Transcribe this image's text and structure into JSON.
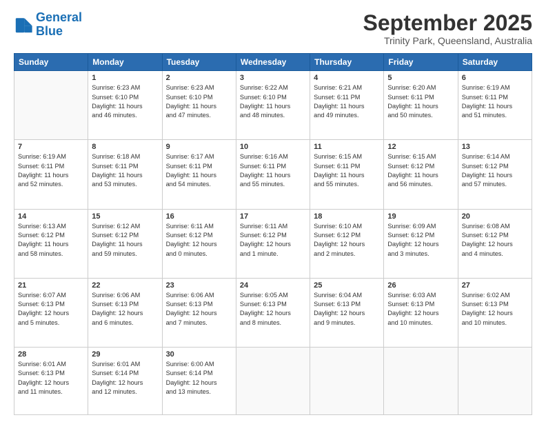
{
  "header": {
    "logo_line1": "General",
    "logo_line2": "Blue",
    "title": "September 2025",
    "subtitle": "Trinity Park, Queensland, Australia"
  },
  "days_of_week": [
    "Sunday",
    "Monday",
    "Tuesday",
    "Wednesday",
    "Thursday",
    "Friday",
    "Saturday"
  ],
  "weeks": [
    [
      {
        "day": "",
        "info": ""
      },
      {
        "day": "1",
        "info": "Sunrise: 6:23 AM\nSunset: 6:10 PM\nDaylight: 11 hours\nand 46 minutes."
      },
      {
        "day": "2",
        "info": "Sunrise: 6:23 AM\nSunset: 6:10 PM\nDaylight: 11 hours\nand 47 minutes."
      },
      {
        "day": "3",
        "info": "Sunrise: 6:22 AM\nSunset: 6:10 PM\nDaylight: 11 hours\nand 48 minutes."
      },
      {
        "day": "4",
        "info": "Sunrise: 6:21 AM\nSunset: 6:11 PM\nDaylight: 11 hours\nand 49 minutes."
      },
      {
        "day": "5",
        "info": "Sunrise: 6:20 AM\nSunset: 6:11 PM\nDaylight: 11 hours\nand 50 minutes."
      },
      {
        "day": "6",
        "info": "Sunrise: 6:19 AM\nSunset: 6:11 PM\nDaylight: 11 hours\nand 51 minutes."
      }
    ],
    [
      {
        "day": "7",
        "info": "Sunrise: 6:19 AM\nSunset: 6:11 PM\nDaylight: 11 hours\nand 52 minutes."
      },
      {
        "day": "8",
        "info": "Sunrise: 6:18 AM\nSunset: 6:11 PM\nDaylight: 11 hours\nand 53 minutes."
      },
      {
        "day": "9",
        "info": "Sunrise: 6:17 AM\nSunset: 6:11 PM\nDaylight: 11 hours\nand 54 minutes."
      },
      {
        "day": "10",
        "info": "Sunrise: 6:16 AM\nSunset: 6:11 PM\nDaylight: 11 hours\nand 55 minutes."
      },
      {
        "day": "11",
        "info": "Sunrise: 6:15 AM\nSunset: 6:11 PM\nDaylight: 11 hours\nand 55 minutes."
      },
      {
        "day": "12",
        "info": "Sunrise: 6:15 AM\nSunset: 6:12 PM\nDaylight: 11 hours\nand 56 minutes."
      },
      {
        "day": "13",
        "info": "Sunrise: 6:14 AM\nSunset: 6:12 PM\nDaylight: 11 hours\nand 57 minutes."
      }
    ],
    [
      {
        "day": "14",
        "info": "Sunrise: 6:13 AM\nSunset: 6:12 PM\nDaylight: 11 hours\nand 58 minutes."
      },
      {
        "day": "15",
        "info": "Sunrise: 6:12 AM\nSunset: 6:12 PM\nDaylight: 11 hours\nand 59 minutes."
      },
      {
        "day": "16",
        "info": "Sunrise: 6:11 AM\nSunset: 6:12 PM\nDaylight: 12 hours\nand 0 minutes."
      },
      {
        "day": "17",
        "info": "Sunrise: 6:11 AM\nSunset: 6:12 PM\nDaylight: 12 hours\nand 1 minute."
      },
      {
        "day": "18",
        "info": "Sunrise: 6:10 AM\nSunset: 6:12 PM\nDaylight: 12 hours\nand 2 minutes."
      },
      {
        "day": "19",
        "info": "Sunrise: 6:09 AM\nSunset: 6:12 PM\nDaylight: 12 hours\nand 3 minutes."
      },
      {
        "day": "20",
        "info": "Sunrise: 6:08 AM\nSunset: 6:12 PM\nDaylight: 12 hours\nand 4 minutes."
      }
    ],
    [
      {
        "day": "21",
        "info": "Sunrise: 6:07 AM\nSunset: 6:13 PM\nDaylight: 12 hours\nand 5 minutes."
      },
      {
        "day": "22",
        "info": "Sunrise: 6:06 AM\nSunset: 6:13 PM\nDaylight: 12 hours\nand 6 minutes."
      },
      {
        "day": "23",
        "info": "Sunrise: 6:06 AM\nSunset: 6:13 PM\nDaylight: 12 hours\nand 7 minutes."
      },
      {
        "day": "24",
        "info": "Sunrise: 6:05 AM\nSunset: 6:13 PM\nDaylight: 12 hours\nand 8 minutes."
      },
      {
        "day": "25",
        "info": "Sunrise: 6:04 AM\nSunset: 6:13 PM\nDaylight: 12 hours\nand 9 minutes."
      },
      {
        "day": "26",
        "info": "Sunrise: 6:03 AM\nSunset: 6:13 PM\nDaylight: 12 hours\nand 10 minutes."
      },
      {
        "day": "27",
        "info": "Sunrise: 6:02 AM\nSunset: 6:13 PM\nDaylight: 12 hours\nand 10 minutes."
      }
    ],
    [
      {
        "day": "28",
        "info": "Sunrise: 6:01 AM\nSunset: 6:13 PM\nDaylight: 12 hours\nand 11 minutes."
      },
      {
        "day": "29",
        "info": "Sunrise: 6:01 AM\nSunset: 6:14 PM\nDaylight: 12 hours\nand 12 minutes."
      },
      {
        "day": "30",
        "info": "Sunrise: 6:00 AM\nSunset: 6:14 PM\nDaylight: 12 hours\nand 13 minutes."
      },
      {
        "day": "",
        "info": ""
      },
      {
        "day": "",
        "info": ""
      },
      {
        "day": "",
        "info": ""
      },
      {
        "day": "",
        "info": ""
      }
    ]
  ]
}
